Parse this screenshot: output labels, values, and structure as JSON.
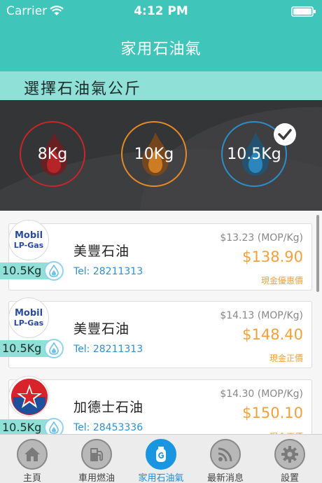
{
  "status_bar": {
    "carrier": "Carrier",
    "time": "4:12 PM"
  },
  "nav": {
    "title": "家用石油氣"
  },
  "section": {
    "title": "選擇石油氣公斤"
  },
  "weights": [
    {
      "label": "8Kg",
      "color": "#c8262a",
      "selected": false
    },
    {
      "label": "10Kg",
      "color": "#e58a26",
      "selected": false
    },
    {
      "label": "10.5Kg",
      "color": "#2b8fc9",
      "selected": true
    }
  ],
  "suppliers": [
    {
      "logo": "mobil-lp-gas",
      "logo_text_1": "Mobil",
      "logo_text_2": "LP-Gas",
      "weight": "10.5Kg",
      "name": "美豐石油",
      "tel": "Tel: 28211313",
      "unit_price": "$13.23 (MOP/Kg)",
      "total": "$138.90",
      "price_type": "現金優惠價"
    },
    {
      "logo": "mobil-lp-gas",
      "logo_text_1": "Mobil",
      "logo_text_2": "LP-Gas",
      "weight": "10.5Kg",
      "name": "美豐石油",
      "tel": "Tel: 28211313",
      "unit_price": "$14.13 (MOP/Kg)",
      "total": "$148.40",
      "price_type": "現金正價"
    },
    {
      "logo": "caltex-star",
      "weight": "10.5Kg",
      "name": "加德士石油",
      "tel": "Tel: 28453336",
      "unit_price": "$14.30 (MOP/Kg)",
      "total": "$150.10",
      "price_type": "現金正價"
    }
  ],
  "tabs": [
    {
      "label": "主頁",
      "icon": "home-icon",
      "active": false
    },
    {
      "label": "車用燃油",
      "icon": "fuel-pump-icon",
      "active": false
    },
    {
      "label": "家用石油氣",
      "icon": "gas-cylinder-icon",
      "active": true
    },
    {
      "label": "最新消息",
      "icon": "rss-icon",
      "active": false
    },
    {
      "label": "設置",
      "icon": "gear-icon",
      "active": false
    }
  ]
}
